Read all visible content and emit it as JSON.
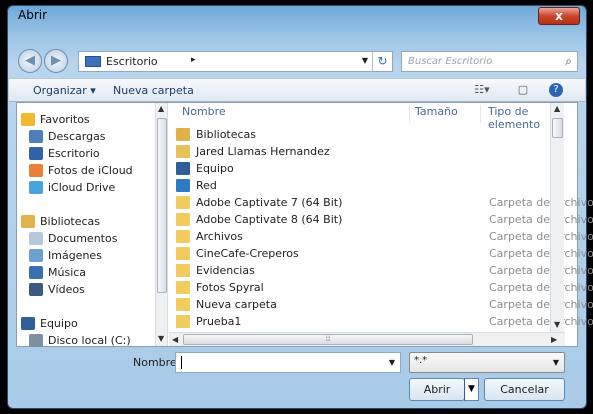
{
  "window": {
    "title": "Abrir",
    "close_glyph": "x"
  },
  "address": {
    "location": "Escritorio",
    "separator": "▸",
    "search_placeholder": "Buscar Escritorio"
  },
  "toolbar": {
    "organize": "Organizar ▾",
    "new_folder": "Nueva carpeta"
  },
  "nav": {
    "items": [
      {
        "label": "Favoritos",
        "icon": "star-icon",
        "color": "#f0b92e"
      },
      {
        "label": "Descargas",
        "icon": "downloads-folder-icon",
        "color": "#4d7fbd"
      },
      {
        "label": "Escritorio",
        "icon": "desktop-icon",
        "color": "#2f63a8"
      },
      {
        "label": "Fotos de iCloud",
        "icon": "icloud-photos-icon",
        "color": "#e9813a"
      },
      {
        "label": "iCloud Drive",
        "icon": "icloud-icon",
        "color": "#4aa3df"
      },
      {
        "label": "Bibliotecas",
        "icon": "libraries-icon",
        "color": "#e2b24a"
      },
      {
        "label": "Documentos",
        "icon": "documents-icon",
        "color": "#b8c8dc"
      },
      {
        "label": "Imágenes",
        "icon": "pictures-icon",
        "color": "#6d9fd0"
      },
      {
        "label": "Música",
        "icon": "music-icon",
        "color": "#3b6fb3"
      },
      {
        "label": "Vídeos",
        "icon": "videos-icon",
        "color": "#3d5a80"
      },
      {
        "label": "Equipo",
        "icon": "computer-icon",
        "color": "#2e5f99"
      },
      {
        "label": "Disco local (C:)",
        "icon": "drive-icon",
        "color": "#7d8fa3"
      }
    ]
  },
  "list": {
    "columns": {
      "name": "Nombre",
      "size": "Tamaño",
      "type": "Tipo de elemento"
    },
    "items": [
      {
        "name": "Bibliotecas",
        "type": "",
        "icon": "libraries-icon",
        "color": "#e2b24a"
      },
      {
        "name": "Jared Llamas Hernandez",
        "type": "",
        "icon": "user-folder-icon",
        "color": "#e7c25c"
      },
      {
        "name": "Equipo",
        "type": "",
        "icon": "computer-icon",
        "color": "#2e5f99"
      },
      {
        "name": "Red",
        "type": "",
        "icon": "network-icon",
        "color": "#2f78c2"
      },
      {
        "name": "Adobe Captivate 7 (64 Bit)",
        "type": "Carpeta de archivos",
        "icon": "folder-icon",
        "color": "#f1cb5c"
      },
      {
        "name": "Adobe Captivate 8 (64 Bit)",
        "type": "Carpeta de archivos",
        "icon": "folder-icon",
        "color": "#f1cb5c"
      },
      {
        "name": "Archivos",
        "type": "Carpeta de archivos",
        "icon": "folder-icon",
        "color": "#f1cb5c"
      },
      {
        "name": "CineCafe-Creperos",
        "type": "Carpeta de archivos",
        "icon": "folder-icon",
        "color": "#f1cb5c"
      },
      {
        "name": "Evidencias",
        "type": "Carpeta de archivos",
        "icon": "folder-icon",
        "color": "#f1cb5c"
      },
      {
        "name": "Fotos Spyral",
        "type": "Carpeta de archivos",
        "icon": "folder-icon",
        "color": "#f1cb5c"
      },
      {
        "name": "Nueva carpeta",
        "type": "Carpeta de archivos",
        "icon": "folder-icon",
        "color": "#f1cb5c"
      },
      {
        "name": "Prueba1",
        "type": "Carpeta de archivos",
        "icon": "folder-icon",
        "color": "#f1cb5c"
      }
    ]
  },
  "bottom": {
    "filename_label": "Nombre:",
    "filename_value": "",
    "filetype": "*.*",
    "open": "Abrir",
    "cancel": "Cancelar"
  }
}
